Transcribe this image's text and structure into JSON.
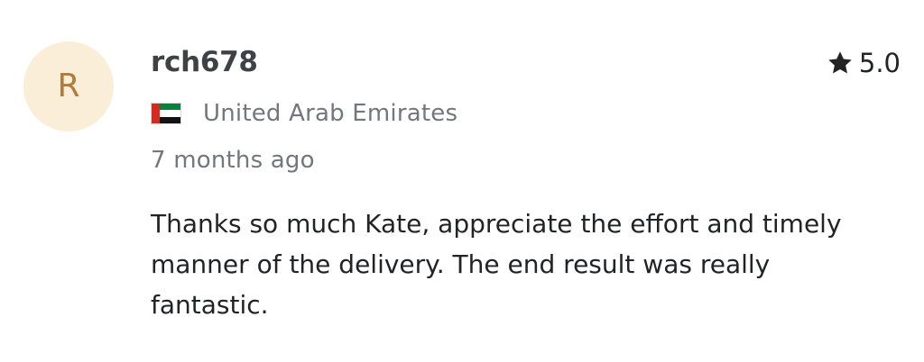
{
  "review": {
    "avatar_initial": "R",
    "username": "rch678",
    "rating": "5.0",
    "country": "United Arab Emirates",
    "time_ago": "7 months ago",
    "text": "Thanks so much Kate, appreciate the effort and timely manner of the delivery. The end result was really fantastic.",
    "icons": {
      "rating": "star-icon",
      "flag": "uae-flag-icon"
    },
    "colors": {
      "avatar_bg": "#fbeed9",
      "avatar_text": "#b07c38",
      "muted_text": "#74767e",
      "main_text": "#222325"
    }
  }
}
